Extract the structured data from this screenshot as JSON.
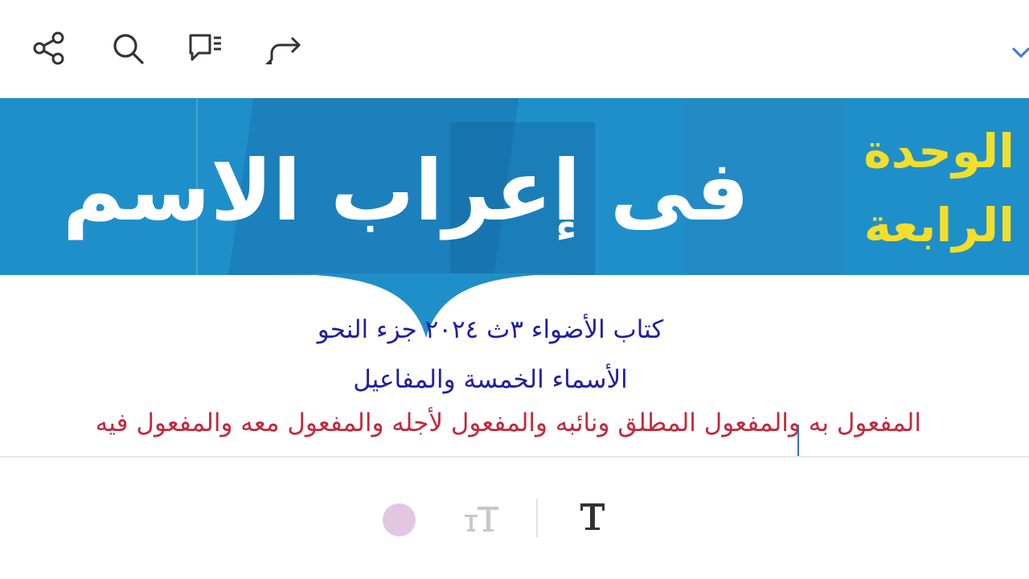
{
  "toolbar": {
    "icons": [
      "share-icon",
      "search-icon",
      "comment-icon",
      "redo-icon",
      "chevron-down-icon"
    ]
  },
  "banner": {
    "title": "فى إعراب الاسم",
    "unit_label_line1": "الوحدة",
    "unit_label_line2": "الرابعة",
    "background_color": "#1f8fc9",
    "unit_label_color": "#f2de2b"
  },
  "document": {
    "line1": "كتاب الأضواء ٣ث ٢٠٢٤ جزء النحو",
    "line2": "الأسماء الخمسة والمفاعيل",
    "line3": "المفعول به والمفعول المطلق  ونائبه والمفعول لأجله والمفعول معه والمفعول فيه",
    "line1_color": "#1f1fa0",
    "line3_color": "#c4283c"
  },
  "bottom_toolbar": {
    "icons": [
      "color-picker-icon",
      "text-size-icon",
      "text-icon"
    ],
    "color_dot": "#e3c6e0"
  }
}
